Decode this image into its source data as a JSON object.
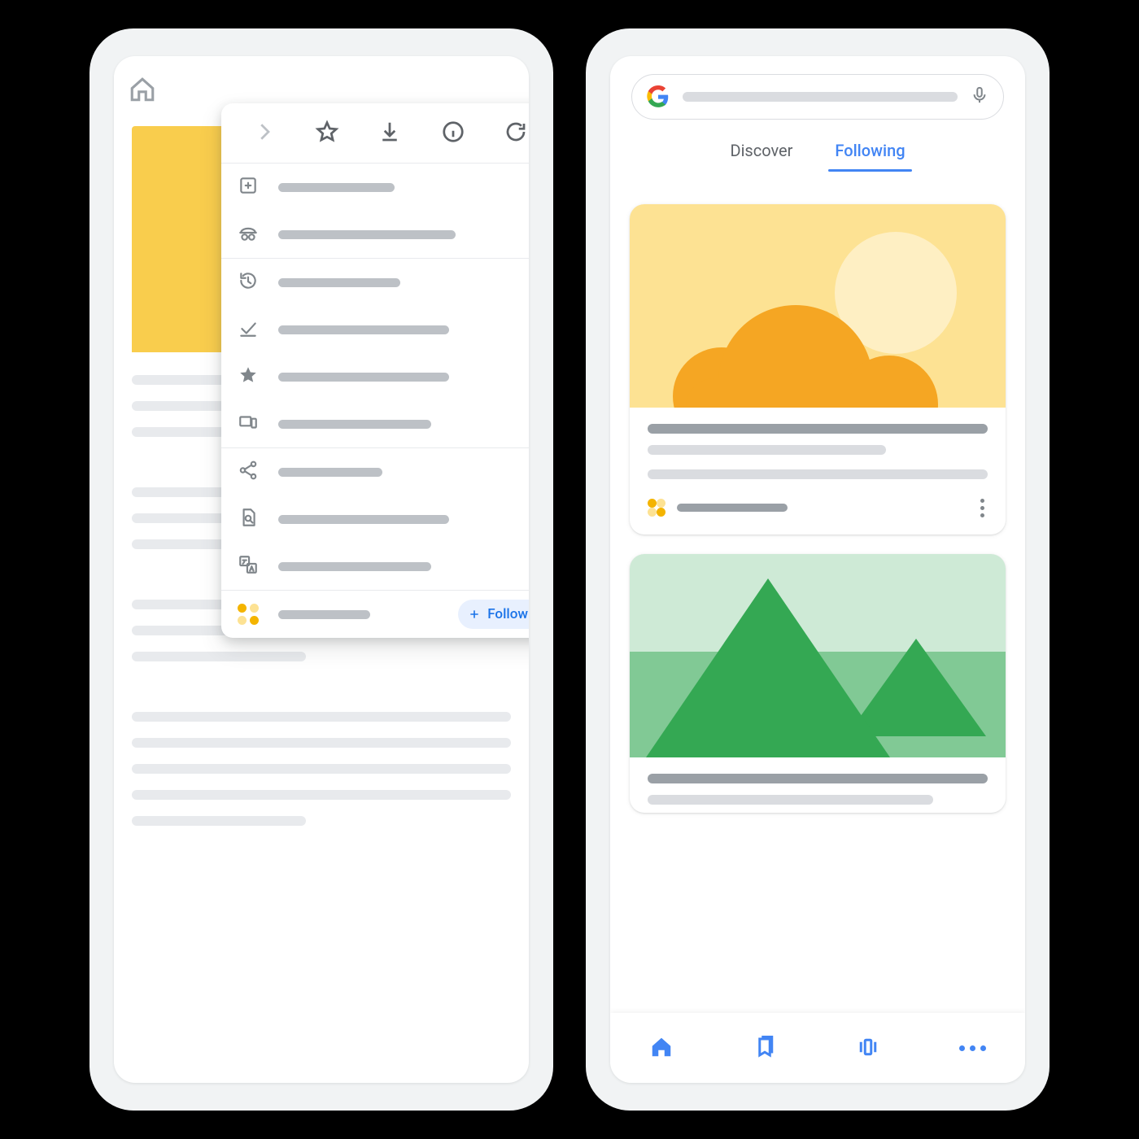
{
  "left_phone": {
    "header": {
      "icon": "home-icon"
    },
    "article_skeleton": {
      "hero_color": "#f9cd4d",
      "paragraphs": 4
    },
    "menu": {
      "toolbar": [
        {
          "icon": "forward-icon",
          "enabled": false
        },
        {
          "icon": "star-icon",
          "enabled": true
        },
        {
          "icon": "download-icon",
          "enabled": true
        },
        {
          "icon": "info-icon",
          "enabled": true
        },
        {
          "icon": "reload-icon",
          "enabled": true
        }
      ],
      "sections": [
        [
          {
            "icon": "new-tab-icon",
            "line_pct": 38
          },
          {
            "icon": "incognito-icon",
            "line_pct": 58
          }
        ],
        [
          {
            "icon": "history-icon",
            "line_pct": 40
          },
          {
            "icon": "downloads-done-icon",
            "line_pct": 56
          },
          {
            "icon": "bookmarks-icon",
            "line_pct": 56
          },
          {
            "icon": "recent-tabs-icon",
            "line_pct": 50
          }
        ],
        [
          {
            "icon": "share-icon",
            "line_pct": 34
          },
          {
            "icon": "find-in-page-icon",
            "line_pct": 56
          },
          {
            "icon": "translate-icon",
            "line_pct": 50
          }
        ]
      ],
      "follow_row": {
        "icon": "publisher-dots-icon",
        "line_pct": 30,
        "button_label": "Follow"
      }
    }
  },
  "right_phone": {
    "search": {
      "logo": "google-logo",
      "placeholder": "",
      "mic": "mic-icon"
    },
    "tabs": {
      "items": [
        "Discover",
        "Following"
      ],
      "active_index": 1
    },
    "feed": [
      {
        "image": "sun-cloud",
        "title_line_pct": 100,
        "line2_pct": 70,
        "line3_pct": 100,
        "publisher_icon": "publisher-dots-icon",
        "publisher_line_pct": 32,
        "overflow": "kebab-icon"
      },
      {
        "image": "hills",
        "title_line_pct": 100,
        "line2_pct": 84
      }
    ],
    "bottom_nav": [
      {
        "icon": "home-solid-icon",
        "active": true
      },
      {
        "icon": "bookmark-icon",
        "active": false
      },
      {
        "icon": "tabs-icon",
        "active": false
      },
      {
        "icon": "more-icon",
        "active": false
      }
    ]
  }
}
